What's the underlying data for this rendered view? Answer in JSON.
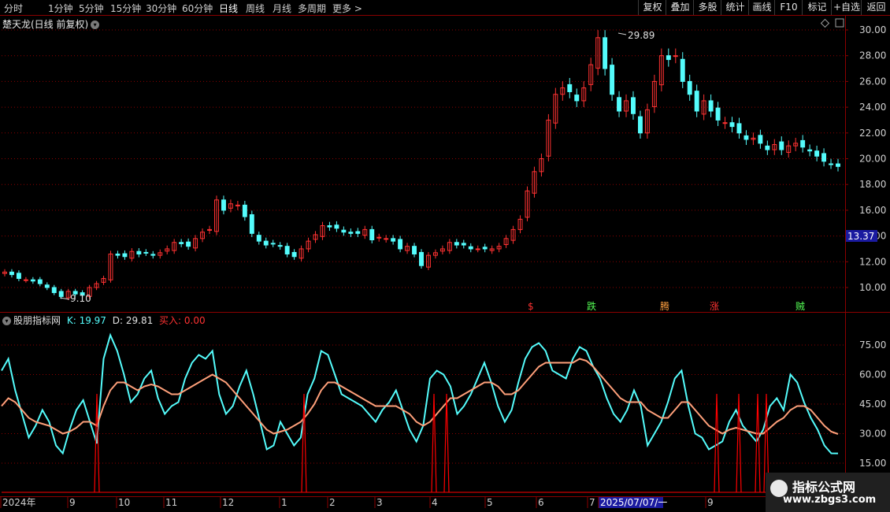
{
  "toolbar": {
    "periods": [
      "分时",
      "1分钟",
      "5分钟",
      "15分钟",
      "30分钟",
      "60分钟",
      "日线",
      "周线",
      "月线",
      "多周期",
      "更多 >"
    ],
    "active_period": "日线",
    "tools": [
      "复权",
      "叠加",
      "多股",
      "统计",
      "画线",
      "F10",
      "标记",
      "+自选",
      "返回"
    ]
  },
  "main": {
    "title": "楚天龙(日线 前复权)",
    "high_label": "29.89",
    "low_label": "9.10",
    "current_price": "13.37",
    "price_ticks": [
      "30.00",
      "28.00",
      "26.00",
      "24.00",
      "22.00",
      "20.00",
      "18.00",
      "16.00",
      "14.00",
      "12.00",
      "10.00"
    ],
    "markers": [
      "$",
      "跌",
      "腾",
      "涨",
      "贼"
    ]
  },
  "indicator": {
    "name": "股朋指标网",
    "k_label": "K: 19.97",
    "d_label": "D: 29.81",
    "buy_label": "买入: 0.00",
    "ticks": [
      "75.00",
      "60.00",
      "45.00",
      "30.00",
      "15.00"
    ]
  },
  "timeline": {
    "labels": [
      "2024年",
      "9",
      "10",
      "11",
      "12",
      "1",
      "2",
      "3",
      "4",
      "5",
      "6",
      "7",
      "2025/07/07/一",
      "9"
    ]
  },
  "watermark": {
    "line1": "指标公式网",
    "line2": "www.zbgs3.com"
  },
  "colors": {
    "up": "#ff3232",
    "down": "#54fcfc",
    "grid": "#8b0000",
    "k_line": "#54fcfc",
    "d_line": "#ffa07a",
    "buy_line": "#ff0000"
  },
  "chart_data": {
    "type": "line",
    "title": "楚天龙(日线 前复权)",
    "price_range": [
      9.0,
      30.5
    ],
    "price_closes": [
      11.2,
      11.0,
      10.7,
      10.6,
      10.5,
      10.3,
      10.0,
      9.6,
      9.3,
      9.7,
      9.5,
      9.4,
      10.0,
      10.3,
      10.7,
      12.6,
      12.5,
      12.4,
      12.8,
      12.6,
      12.7,
      12.5,
      12.7,
      13.0,
      13.5,
      13.4,
      13.2,
      13.8,
      14.3,
      14.5,
      16.8,
      16.0,
      16.5,
      16.4,
      15.5,
      14.2,
      13.6,
      13.3,
      13.4,
      13.2,
      12.6,
      12.4,
      13.0,
      13.6,
      14.1,
      14.8,
      14.7,
      14.6,
      14.3,
      14.2,
      14.2,
      14.5,
      13.7,
      13.9,
      13.8,
      13.6,
      13.0,
      13.2,
      12.6,
      11.7,
      12.5,
      12.7,
      13.0,
      13.5,
      13.3,
      13.3,
      13.0,
      13.0,
      13.0,
      13.0,
      13.2,
      13.8,
      14.5,
      15.3,
      17.5,
      19.0,
      20.0,
      23.0,
      25.0,
      25.5,
      25.2,
      24.5,
      25.5,
      27.3,
      29.4,
      27.0,
      25.0,
      23.7,
      24.5,
      23.5,
      22.0,
      23.8,
      26.0,
      28.0,
      27.7,
      28.0,
      26.0,
      25.0,
      23.7,
      24.5,
      23.7,
      23.0,
      22.8,
      22.5,
      22.0,
      21.5,
      21.6,
      21.2,
      20.7,
      21.1,
      20.7,
      21.0,
      21.2,
      20.9,
      20.6,
      20.2,
      19.8,
      19.6,
      19.4
    ],
    "series": [
      {
        "name": "K",
        "values": [
          62,
          68,
          52,
          40,
          28,
          34,
          42,
          36,
          24,
          20,
          32,
          42,
          47,
          36,
          25,
          68,
          80,
          72,
          60,
          46,
          50,
          58,
          62,
          48,
          40,
          44,
          46,
          58,
          66,
          70,
          68,
          72,
          50,
          40,
          44,
          54,
          62,
          50,
          36,
          22,
          24,
          36,
          30,
          24,
          28,
          50,
          58,
          72,
          70,
          60,
          50,
          48,
          46,
          44,
          40,
          36,
          42,
          46,
          52,
          42,
          32,
          26,
          34,
          58,
          62,
          60,
          54,
          40,
          44,
          50,
          58,
          66,
          56,
          44,
          36,
          42,
          56,
          68,
          74,
          76,
          72,
          62,
          60,
          58,
          68,
          74,
          72,
          64,
          58,
          48,
          40,
          36,
          42,
          52,
          44,
          24,
          30,
          36,
          46,
          58,
          62,
          44,
          30,
          28,
          22,
          24,
          26,
          36,
          42,
          34,
          30,
          26,
          32,
          44,
          48,
          42,
          60,
          56,
          46,
          38,
          32,
          24,
          20,
          19.97
        ]
      },
      {
        "name": "D",
        "values": [
          44,
          48,
          46,
          42,
          38,
          36,
          35,
          34,
          32,
          30,
          31,
          33,
          36,
          36,
          34,
          44,
          52,
          56,
          56,
          54,
          52,
          54,
          55,
          54,
          52,
          50,
          50,
          52,
          54,
          56,
          58,
          60,
          58,
          56,
          52,
          48,
          44,
          40,
          36,
          32,
          30,
          31,
          32,
          34,
          36,
          40,
          45,
          52,
          56,
          56,
          54,
          52,
          50,
          48,
          46,
          44,
          44,
          44,
          44,
          42,
          40,
          36,
          34,
          36,
          40,
          44,
          48,
          48,
          50,
          52,
          54,
          56,
          56,
          54,
          50,
          50,
          52,
          56,
          60,
          64,
          66,
          66,
          66,
          66,
          66,
          68,
          67,
          64,
          60,
          56,
          52,
          48,
          46,
          46,
          46,
          42,
          40,
          38,
          38,
          42,
          46,
          46,
          42,
          38,
          34,
          32,
          30,
          32,
          33,
          32,
          31,
          30,
          30,
          33,
          36,
          38,
          42,
          44,
          44,
          42,
          38,
          34,
          31,
          29.81
        ]
      }
    ],
    "buy_signal_count": 10
  }
}
